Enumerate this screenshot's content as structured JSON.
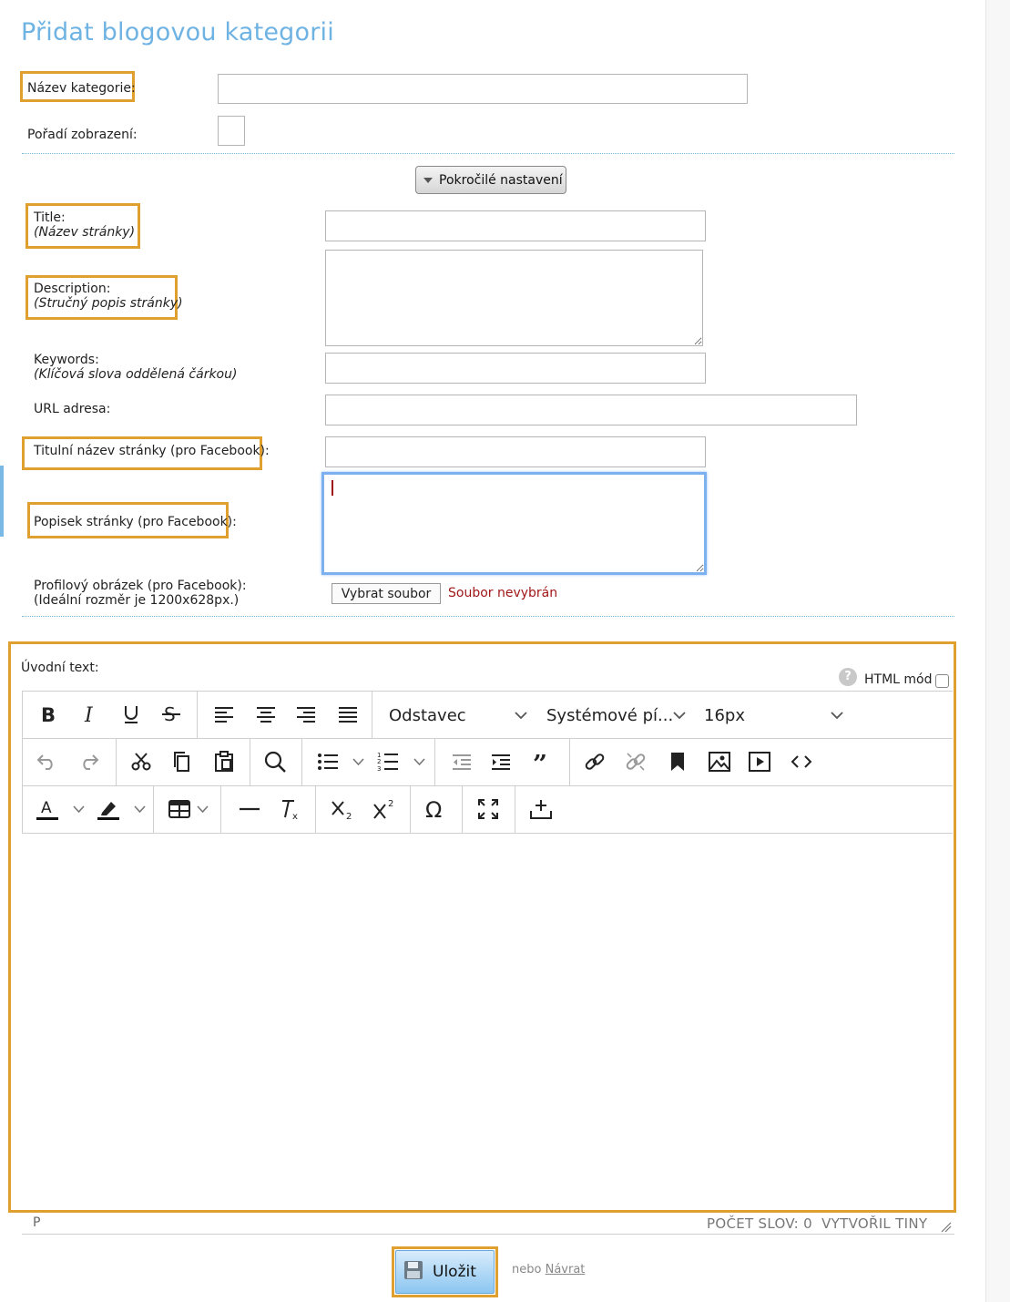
{
  "page": {
    "title": "Přidat blogovou kategorii"
  },
  "form": {
    "category_name_label": "Název kategorie:",
    "display_order_label": "Pořadí zobrazení:",
    "advanced_button": "Pokročilé nastavení",
    "title_label": "Title:",
    "title_hint": "(Název stránky)",
    "description_label": "Description:",
    "description_hint": "(Stručný popis stránky)",
    "keywords_label": "Keywords:",
    "keywords_hint": "(Klíčová slova oddělená čárkou)",
    "url_label": "URL adresa:",
    "fb_title_label": "Titulní název stránky (pro Facebook):",
    "fb_desc_label": "Popisek stránky (pro Facebook):",
    "fb_image_label": "Profilový obrázek (pro Facebook):",
    "fb_image_hint": "(Ideální rozměr je 1200x628px.)",
    "file_button": "Vybrat soubor",
    "file_status": "Soubor nevybrán",
    "intro_label": "Úvodní text:",
    "html_mode_label": "HTML mód",
    "help_glyph": "?"
  },
  "editor": {
    "block_format": "Odstavec",
    "font_family": "Systémové pí...",
    "font_size": "16px",
    "status_path": "P",
    "word_count": "POČET SLOV: 0",
    "powered_by": "VYTVOŘIL TINY",
    "icons": [
      "bold-icon",
      "italic-icon",
      "underline-icon",
      "strikethrough-icon",
      "align-left-icon",
      "align-center-icon",
      "align-right-icon",
      "align-justify-icon",
      "undo-icon",
      "redo-icon",
      "cut-icon",
      "copy-icon",
      "paste-icon",
      "search-icon",
      "bullet-list-icon",
      "numbered-list-icon",
      "outdent-icon",
      "indent-icon",
      "blockquote-icon",
      "link-icon",
      "unlink-icon",
      "bookmark-icon",
      "image-icon",
      "media-icon",
      "code-icon",
      "text-color-icon",
      "highlight-color-icon",
      "table-icon",
      "horizontal-rule-icon",
      "clear-formatting-icon",
      "subscript-icon",
      "superscript-icon",
      "special-char-icon",
      "fullscreen-icon",
      "insert-icon"
    ]
  },
  "footer": {
    "save_button": "Uložit",
    "or_text": "nebo",
    "back_link": "Návrat"
  },
  "colors": {
    "title": "#6fb3e3",
    "highlight": "#e0a030",
    "focus": "#7cb0ef",
    "error_text": "#a01818"
  }
}
